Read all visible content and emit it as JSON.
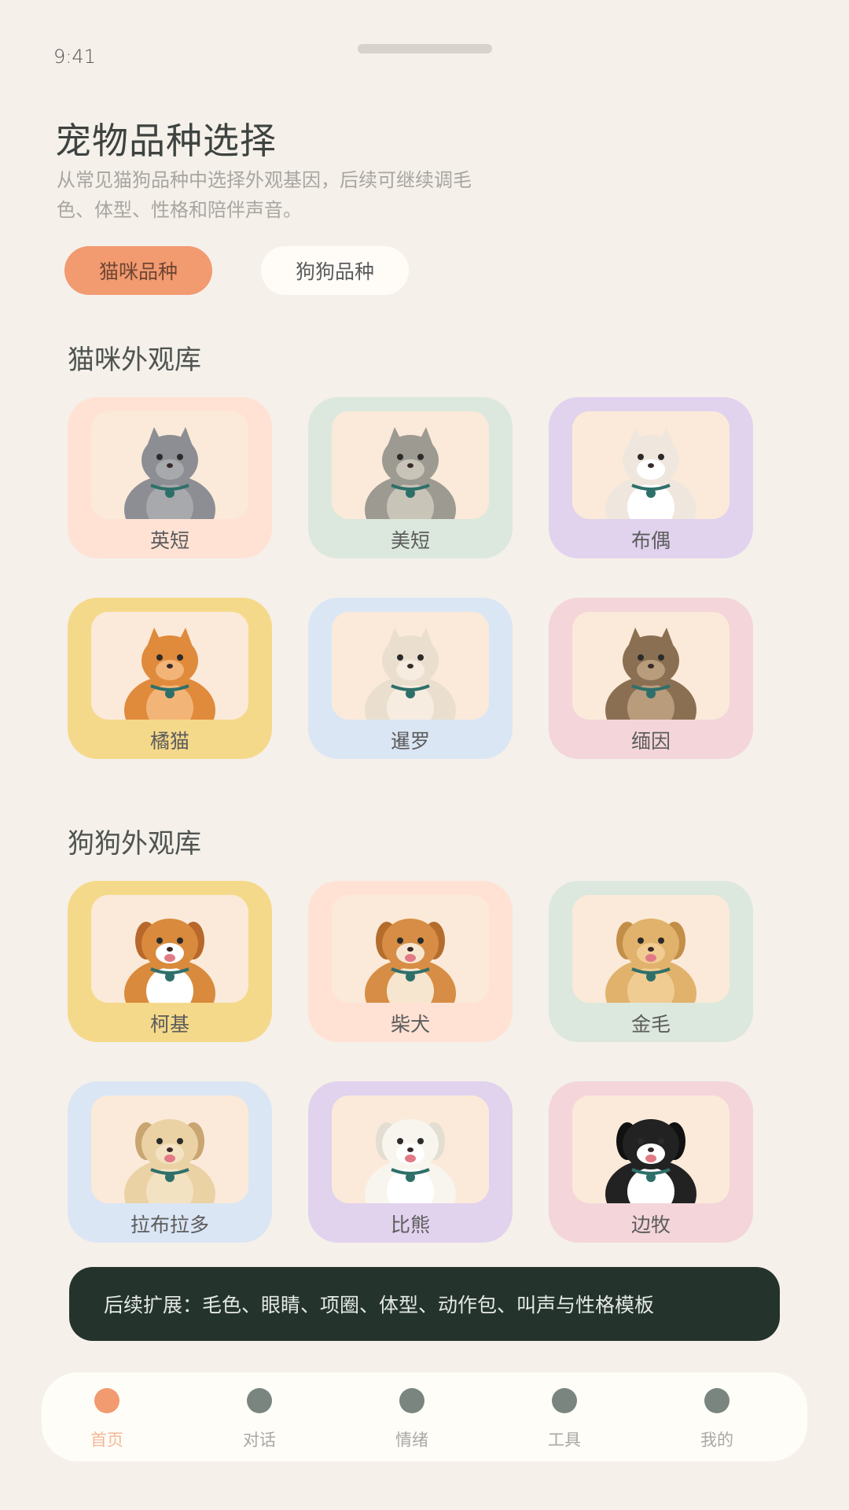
{
  "status": {
    "time": "9:41"
  },
  "header": {
    "title": "宠物品种选择",
    "subtitle": "从常见猫狗品种中选择外观基因，后续可继续调毛色、体型、性格和陪伴声音。"
  },
  "segments": [
    {
      "label": "猫咪品种",
      "active": true
    },
    {
      "label": "狗狗品种",
      "active": false
    }
  ],
  "cat_section": {
    "title": "猫咪外观库",
    "items": [
      {
        "label": "英短",
        "card_color": "#ffe2d4",
        "icon": "british-shorthair-cat"
      },
      {
        "label": "美短",
        "card_color": "#dce8dd",
        "icon": "american-shorthair-cat"
      },
      {
        "label": "布偶",
        "card_color": "#e1d2ee",
        "icon": "ragdoll-cat"
      },
      {
        "label": "橘猫",
        "card_color": "#f5d98a",
        "icon": "orange-tabby-cat"
      },
      {
        "label": "暹罗",
        "card_color": "#dbe6f5",
        "icon": "siamese-cat"
      },
      {
        "label": "缅因",
        "card_color": "#f3d5da",
        "icon": "maine-coon-cat"
      }
    ]
  },
  "dog_section": {
    "title": "狗狗外观库",
    "items": [
      {
        "label": "柯基",
        "card_color": "#f5d98a",
        "icon": "corgi-dog"
      },
      {
        "label": "柴犬",
        "card_color": "#ffe2d4",
        "icon": "shiba-dog"
      },
      {
        "label": "金毛",
        "card_color": "#dce8dd",
        "icon": "golden-retriever-dog"
      },
      {
        "label": "拉布拉多",
        "card_color": "#dbe6f5",
        "icon": "labrador-dog"
      },
      {
        "label": "比熊",
        "card_color": "#e1d2ee",
        "icon": "bichon-dog"
      },
      {
        "label": "边牧",
        "card_color": "#f3d5da",
        "icon": "border-collie-dog"
      }
    ]
  },
  "banner": {
    "text": "后续扩展：毛色、眼睛、项圈、体型、动作包、叫声与性格模板"
  },
  "tabbar": {
    "items": [
      {
        "label": "首页",
        "active": true
      },
      {
        "label": "对话",
        "active": false
      },
      {
        "label": "情绪",
        "active": false
      },
      {
        "label": "工具",
        "active": false
      },
      {
        "label": "我的",
        "active": false
      }
    ]
  },
  "colors": {
    "accent": "#f29a70",
    "banner_bg": "#24342d",
    "page_bg": "#f5f0ea"
  }
}
